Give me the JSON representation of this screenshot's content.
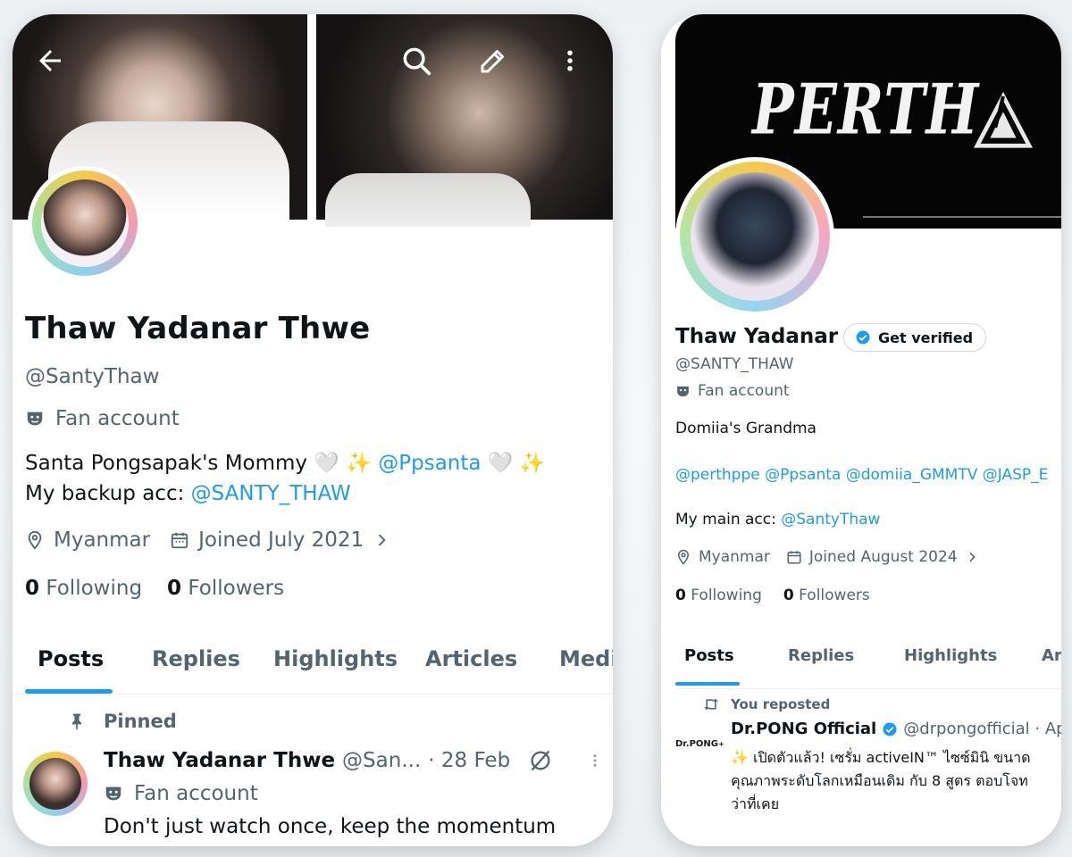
{
  "left_profile": {
    "topbar": {
      "back_icon": "arrow-left-icon",
      "search_icon": "search-icon",
      "edit_icon": "pencil-icon",
      "more_icon": "more-vertical-icon"
    },
    "display_name": "Thaw Yadanar Thwe",
    "handle": "@SantyThaw",
    "fan_account_label": "Fan account",
    "bio_line1_text": "Santa Pongsapak's Mommy",
    "bio_line1_emoji": "🤍 ✨",
    "bio_line1_mention": "@Ppsanta",
    "bio_line1_emoji_end": "🤍 ✨",
    "bio_line2_text": "My backup acc:",
    "bio_line2_mention": "@SANTY_THAW",
    "location": "Myanmar",
    "joined": "Joined July 2021",
    "following_count": "0",
    "following_label": "Following",
    "followers_count": "0",
    "followers_label": "Followers",
    "tabs": [
      "Posts",
      "Replies",
      "Highlights",
      "Articles",
      "Medi"
    ],
    "pinned_label": "Pinned",
    "tweet": {
      "name": "Thaw Yadanar Thwe",
      "handle": "@San...",
      "date": "· 28 Feb",
      "fan_label": "Fan account",
      "text": "Don't just watch once, keep the momentum"
    }
  },
  "right_profile": {
    "banner_text": "PERTH",
    "display_name": "Thaw Yadanar",
    "verify_button": "Get verified",
    "handle": "@SANTY_THAW",
    "fan_account_label": "Fan account",
    "bio": "Domiia's Grandma",
    "mentions": "@perthppe @Ppsanta @domiia_GMMTV @JASP_E",
    "main_acc_label": "My main acc:",
    "main_acc_mention": "@SantyThaw",
    "location": "Myanmar",
    "joined": "Joined August 2024",
    "following_count": "0",
    "following_label": "Following",
    "followers_count": "0",
    "followers_label": "Followers",
    "tabs": [
      "Posts",
      "Replies",
      "Highlights",
      "Ar"
    ],
    "repost_label": "You reposted",
    "post": {
      "logo_text": "Dr.PONG",
      "name": "Dr.PONG Official",
      "handle": "@drpongofficial · Ap",
      "line1": "✨ เปิดตัวแล้ว! เซรั่ม activeIN™ ไซซ์มินิ ขนาด",
      "line2": "คุณภาพระดับโลกเหมือนเดิม กับ 8 สูตร ตอบโจท",
      "line3": "ว่าที่เคย"
    }
  },
  "colors": {
    "accent": "#1d9bf0",
    "text_primary": "#0f1419",
    "text_secondary": "#536471"
  }
}
